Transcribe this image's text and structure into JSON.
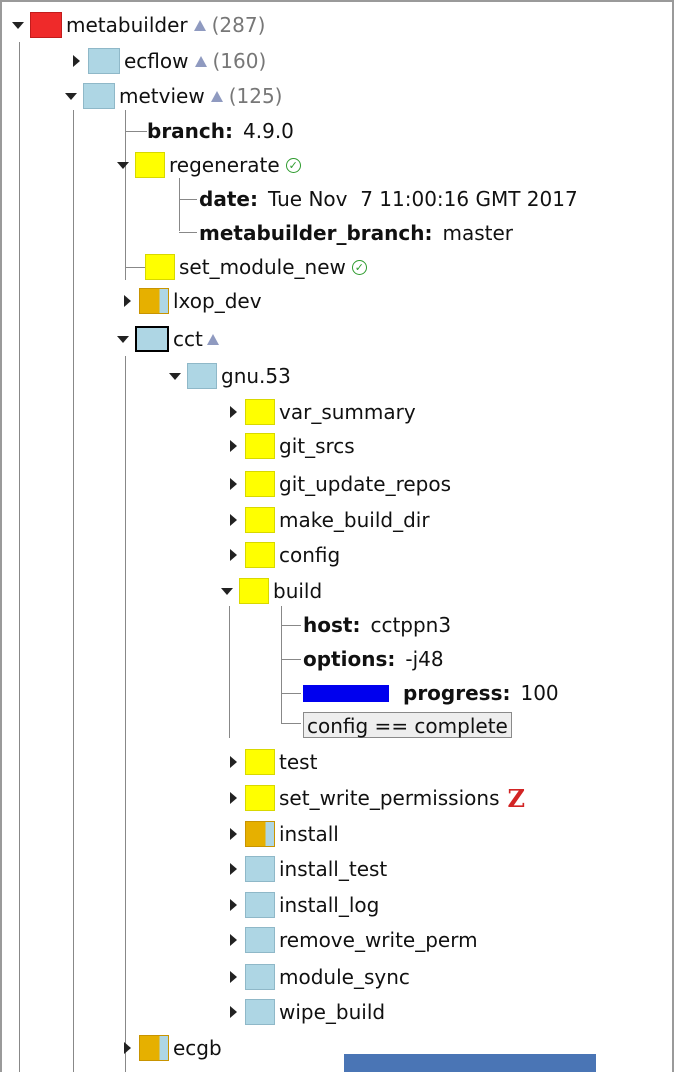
{
  "tree": {
    "root": {
      "name": "metabuilder",
      "count": "(287)"
    },
    "ecflow": {
      "name": "ecflow",
      "count": "(160)"
    },
    "metview": {
      "name": "metview",
      "count": "(125)",
      "branch": {
        "key": "branch:",
        "value": "4.9.0"
      },
      "regenerate": {
        "name": "regenerate",
        "date": {
          "key": "date:",
          "value": "Tue Nov  7 11:00:16 GMT 2017"
        },
        "metabuilder_branch": {
          "key": "metabuilder_branch:",
          "value": "master"
        }
      },
      "set_module_new": "set_module_new",
      "lxop_dev": "lxop_dev",
      "cct": {
        "name": "cct",
        "gnu53": {
          "name": "gnu.53",
          "tasks_before_build": [
            "var_summary",
            "git_srcs",
            "git_update_repos",
            "make_build_dir",
            "config"
          ],
          "build": {
            "name": "build",
            "host": {
              "key": "host:",
              "value": "cctppn3"
            },
            "options": {
              "key": "options:",
              "value": "-j48"
            },
            "progress": {
              "key": "progress:",
              "value": "100",
              "fill_percent": 100
            },
            "trigger": "config == complete"
          },
          "test": "test",
          "set_write_permissions": "set_write_permissions",
          "install": "install",
          "tasks_after_install": [
            "install_test",
            "install_log",
            "remove_write_perm",
            "module_sync",
            "wipe_build"
          ]
        }
      },
      "ecgb": "ecgb"
    }
  },
  "colors": {
    "aborted": "#ef2a2a",
    "queued": "#aed6e4",
    "submitted": "#ffff00",
    "active": "#e6b000",
    "meter": "#0000ee"
  },
  "icons": {
    "expanded": "triangle-down-icon",
    "collapsed": "triangle-right-icon",
    "status_up": "triangle-up-icon",
    "complete": "check-circle-icon",
    "zombie": "zombie-z-icon"
  }
}
